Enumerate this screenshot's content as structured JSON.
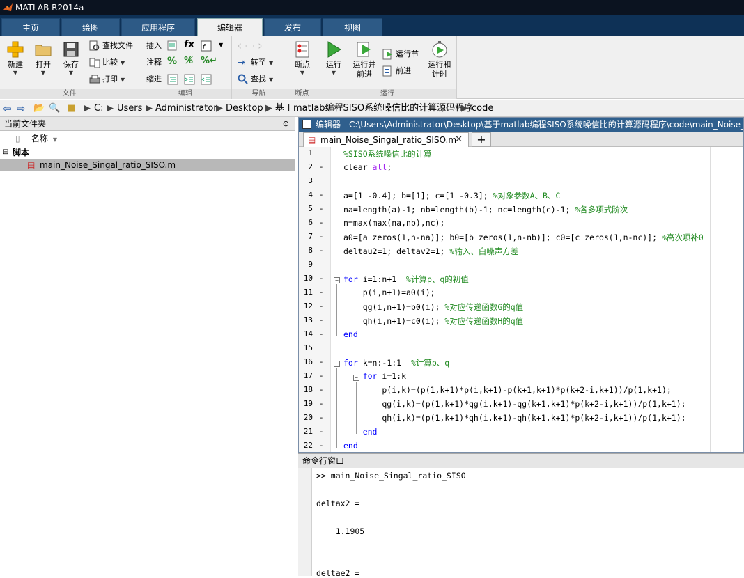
{
  "window": {
    "title": "MATLAB R2014a"
  },
  "tabs": [
    {
      "label": "主页"
    },
    {
      "label": "绘图"
    },
    {
      "label": "应用程序"
    },
    {
      "label": "编辑器",
      "active": true
    },
    {
      "label": "发布"
    },
    {
      "label": "视图"
    }
  ],
  "ribbon": {
    "file": {
      "section": "文件",
      "new": "新建",
      "open": "打开",
      "save": "保存",
      "find_files": "查找文件",
      "compare": "比较",
      "print": "打印"
    },
    "edit": {
      "section": "编辑",
      "insert": "插入",
      "comment": "注释",
      "indent": "缩进",
      "fx": "fx"
    },
    "nav": {
      "section": "导航",
      "goto": "转至",
      "find": "查找"
    },
    "breakpoints": {
      "section": "断点",
      "breakpoints": "断点"
    },
    "run": {
      "section": "运行",
      "run": "运行",
      "run_advance_1": "运行并",
      "run_advance_2": "前进",
      "run_section": "运行节",
      "advance": "前进",
      "run_time_1": "运行和",
      "run_time_2": "计时"
    }
  },
  "address": {
    "parts": [
      "C:",
      "Users",
      "Administrator",
      "Desktop",
      "基于matlab编程SISO系统噪信比的计算源码程序",
      "code"
    ]
  },
  "current_folder": {
    "title": "当前文件夹",
    "column": "名称",
    "group": "脚本",
    "file": "main_Noise_Singal_ratio_SISO.m"
  },
  "editor": {
    "title": "编辑器 - C:\\Users\\Administrator\\Desktop\\基于matlab编程SISO系统噪信比的计算源码程序\\code\\main_Noise_Singal_ratio_SISO.m",
    "tab": "main_Noise_Singal_ratio_SISO.m",
    "lines": [
      {
        "n": "1",
        "dash": "",
        "segs": [
          {
            "t": "%SISO系统噪信比的计算",
            "c": "cm"
          }
        ]
      },
      {
        "n": "2",
        "dash": "-",
        "segs": [
          {
            "t": "clear ",
            "c": ""
          },
          {
            "t": "all",
            "c": "str"
          },
          {
            "t": ";",
            "c": ""
          }
        ]
      },
      {
        "n": "3",
        "dash": "",
        "segs": []
      },
      {
        "n": "4",
        "dash": "-",
        "segs": [
          {
            "t": "a=[1 -0.4]; b=[1]; c=[1 -0.3]; ",
            "c": ""
          },
          {
            "t": "%对象参数A、B、C",
            "c": "cm"
          }
        ]
      },
      {
        "n": "5",
        "dash": "-",
        "segs": [
          {
            "t": "na=length(a)-1; nb=length(b)-1; nc=length(c)-1; ",
            "c": ""
          },
          {
            "t": "%各多项式阶次",
            "c": "cm"
          }
        ]
      },
      {
        "n": "6",
        "dash": "-",
        "segs": [
          {
            "t": "n=max(max(na,nb),nc);",
            "c": ""
          }
        ]
      },
      {
        "n": "7",
        "dash": "-",
        "segs": [
          {
            "t": "a0=[a zeros(1,n-na)]; b0=[b zeros(1,n-nb)]; c0=[c zeros(1,n-nc)]; ",
            "c": ""
          },
          {
            "t": "%高次项补0",
            "c": "cm"
          }
        ]
      },
      {
        "n": "8",
        "dash": "-",
        "segs": [
          {
            "t": "deltau2=1; deltav2=1; ",
            "c": ""
          },
          {
            "t": "%输入、白噪声方差",
            "c": "cm"
          }
        ]
      },
      {
        "n": "9",
        "dash": "",
        "segs": []
      },
      {
        "n": "10",
        "dash": "-",
        "segs": [
          {
            "t": "for ",
            "c": "kw"
          },
          {
            "t": "i=1:n+1  ",
            "c": ""
          },
          {
            "t": "%计算p、q的初值",
            "c": "cm"
          }
        ]
      },
      {
        "n": "11",
        "dash": "-",
        "segs": [
          {
            "t": "    p(i,n+1)=a0(i);",
            "c": ""
          }
        ]
      },
      {
        "n": "12",
        "dash": "-",
        "segs": [
          {
            "t": "    qg(i,n+1)=b0(i); ",
            "c": ""
          },
          {
            "t": "%对应传递函数G的q值",
            "c": "cm"
          }
        ]
      },
      {
        "n": "13",
        "dash": "-",
        "segs": [
          {
            "t": "    qh(i,n+1)=c0(i); ",
            "c": ""
          },
          {
            "t": "%对应传递函数H的q值",
            "c": "cm"
          }
        ]
      },
      {
        "n": "14",
        "dash": "-",
        "segs": [
          {
            "t": "end",
            "c": "kw"
          }
        ]
      },
      {
        "n": "15",
        "dash": "",
        "segs": []
      },
      {
        "n": "16",
        "dash": "-",
        "segs": [
          {
            "t": "for ",
            "c": "kw"
          },
          {
            "t": "k=n:-1:1  ",
            "c": ""
          },
          {
            "t": "%计算p、q",
            "c": "cm"
          }
        ]
      },
      {
        "n": "17",
        "dash": "-",
        "segs": [
          {
            "t": "    ",
            "c": ""
          },
          {
            "t": "for ",
            "c": "kw"
          },
          {
            "t": "i=1:k",
            "c": ""
          }
        ]
      },
      {
        "n": "18",
        "dash": "-",
        "segs": [
          {
            "t": "        p(i,k)=(p(1,k+1)*p(i,k+1)-p(k+1,k+1)*p(k+2-i,k+1))/p(1,k+1);",
            "c": ""
          }
        ]
      },
      {
        "n": "19",
        "dash": "-",
        "segs": [
          {
            "t": "        qg(i,k)=(p(1,k+1)*qg(i,k+1)-qg(k+1,k+1)*p(k+2-i,k+1))/p(1,k+1);",
            "c": ""
          }
        ]
      },
      {
        "n": "20",
        "dash": "-",
        "segs": [
          {
            "t": "        qh(i,k)=(p(1,k+1)*qh(i,k+1)-qh(k+1,k+1)*p(k+2-i,k+1))/p(1,k+1);",
            "c": ""
          }
        ]
      },
      {
        "n": "21",
        "dash": "-",
        "segs": [
          {
            "t": "    ",
            "c": ""
          },
          {
            "t": "end",
            "c": "kw"
          }
        ]
      },
      {
        "n": "22",
        "dash": "-",
        "segs": [
          {
            "t": "end",
            "c": "kw"
          }
        ]
      }
    ]
  },
  "command_window": {
    "title": "命令行窗口",
    "lines": [
      ">> main_Noise_Singal_ratio_SISO",
      "",
      "deltax2 =",
      "",
      "    1.1905",
      "",
      "",
      "deltae2 ="
    ]
  },
  "icons": {
    "new": "plus-icon",
    "open": "folder-icon",
    "save": "floppy-icon",
    "run": "play-icon"
  }
}
